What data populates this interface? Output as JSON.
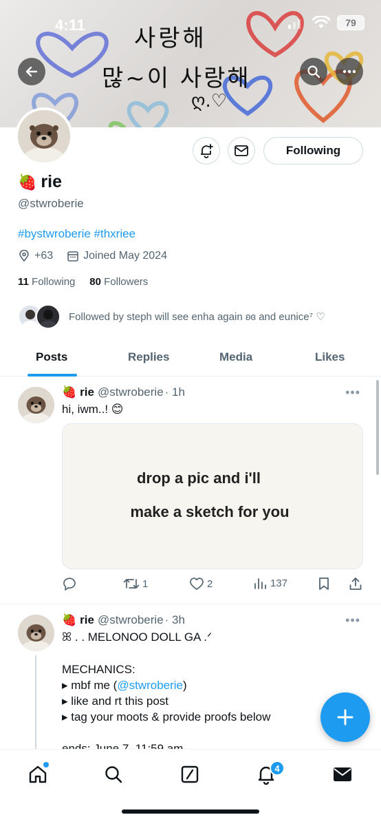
{
  "status_bar": {
    "time": "4:11",
    "battery": "79"
  },
  "banner": {
    "line1": "사랑해",
    "line2": "많~이 사랑해",
    "doodle": "ღ.♡"
  },
  "profile": {
    "display_name": "rie",
    "name_emoji": "🍓",
    "handle": "@stwroberie",
    "bio": "#bystwroberie #thxriee",
    "location": "+63",
    "joined": "Joined May 2024",
    "following_count": "11",
    "following_label": "Following",
    "followers_count": "80",
    "followers_label": "Followers",
    "followed_by": "Followed by steph will see enha again ʚɞ and eunice⁷ ♡",
    "following_button": "Following"
  },
  "tabs": [
    {
      "label": "Posts"
    },
    {
      "label": "Replies"
    },
    {
      "label": "Media"
    },
    {
      "label": "Likes"
    }
  ],
  "posts": [
    {
      "name": "rie",
      "emoji": "🍓",
      "handle": "@stwroberie",
      "time": "· 1h",
      "text": "hi, iwm..! 😊",
      "media_line1": "drop a pic and i'll",
      "media_line2": "make a sketch for you",
      "retweets": "1",
      "likes": "2",
      "views": "137"
    },
    {
      "name": "rie",
      "emoji": "🍓",
      "handle": "@stwroberie",
      "time": "· 3h",
      "line1": "ꕤ . . MELONOO DOLL GA .ᐟ",
      "line2": "MECHANICS:",
      "line3a": "▸ mbf me (",
      "line3_link": "@stwroberie",
      "line3b": ")",
      "line4": "▸ like and rt this post",
      "line5": "▸ tag your moots & provide proofs below",
      "line6": "ends: June 7, 11:59 am"
    }
  ],
  "notifications_badge": "4",
  "colors": {
    "accent": "#1d9bf0",
    "text": "#0f1419",
    "muted": "#536471"
  },
  "icons": [
    "back-arrow-icon",
    "search-icon",
    "more-icon",
    "notify-bell-icon",
    "mail-icon",
    "location-icon",
    "calendar-icon",
    "reply-icon",
    "retweet-icon",
    "heart-icon",
    "views-icon",
    "bookmark-icon",
    "share-icon",
    "plus-icon",
    "home-icon",
    "grok-icon",
    "bell-icon"
  ]
}
